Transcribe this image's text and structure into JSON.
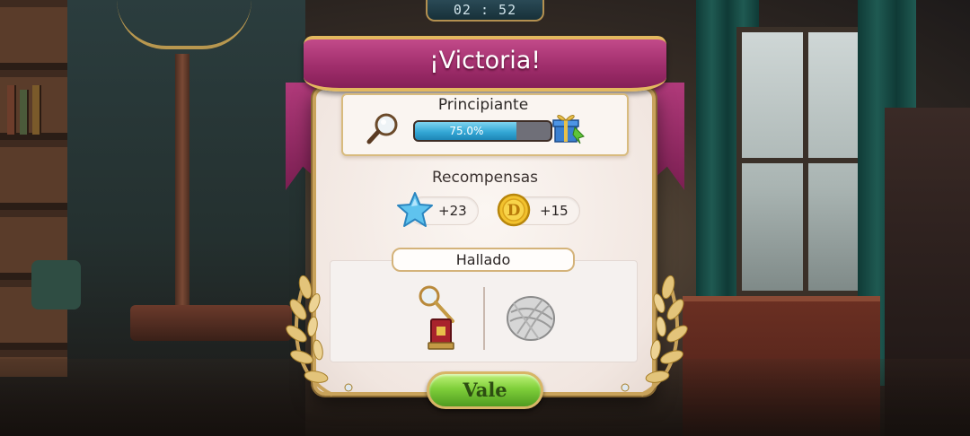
{
  "hud": {
    "timer": "02 : 52"
  },
  "dialog": {
    "title": "¡Victoria!",
    "level": {
      "name": "Principiante",
      "progress_label": "75.0%",
      "progress_fraction": 0.75
    },
    "rewards": {
      "heading": "Recompensas",
      "items": [
        {
          "icon": "star-icon",
          "amount": "+23"
        },
        {
          "icon": "coin-icon",
          "amount": "+15"
        }
      ]
    },
    "found": {
      "heading": "Hallado",
      "items": [
        {
          "icon": "magnifier-stamp-icon"
        },
        {
          "icon": "yarn-ball-icon"
        }
      ]
    },
    "ok_label": "Vale"
  },
  "colors": {
    "ribbon": "#a02e6c",
    "progress_fill": "#34a8d6",
    "button_green": "#7fcf3a",
    "gold_trim": "#c9a35b"
  }
}
